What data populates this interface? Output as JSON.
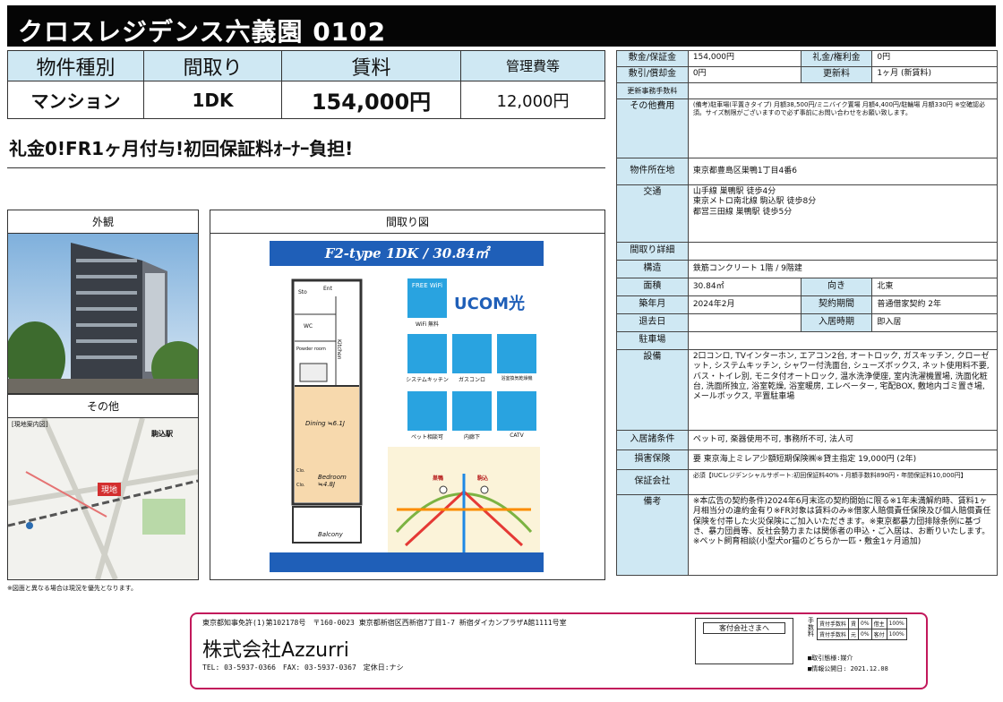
{
  "title": "クロスレジデンス六義園 0102",
  "summary": {
    "headers": [
      "物件種別",
      "間取り",
      "賃料",
      "管理費等"
    ],
    "values": [
      "マンション",
      "1DK",
      "154,000円",
      "12,000円"
    ]
  },
  "catch_copy": "礼金0!FR1ヶ月付与!初回保証料ｵｰﾅｰ負担!",
  "exterior": {
    "label": "外観"
  },
  "other": {
    "label": "その他",
    "map_title": "[現地案内図]",
    "map_marker": "現地",
    "station_label": "駒込駅"
  },
  "floorplan": {
    "label": "間取り図",
    "banner": "F2-type 1DK / 30.84㎡",
    "rooms": [
      "Ent",
      "Sto",
      "WC",
      "Powder room",
      "Kitchen",
      "Dining ≒6.1J",
      "Bedroom ≒4.8J",
      "Clo.",
      "Clo.",
      "Balcony"
    ],
    "features": [
      "FREE WiFi",
      "WiFi 無料",
      "システムキッチン",
      "ガスコンロ",
      "浴室換気乾燥機",
      "ペット相談可",
      "内廊下",
      "CATV"
    ],
    "ucom_text": "UCOM光",
    "map_stations": [
      "巣鴨",
      "駒込"
    ]
  },
  "disclaimer": "※図面と異なる場合は現況を優先となります。",
  "spec": {
    "deposit_label": "敷金/保証金",
    "deposit": "154,000円",
    "key_money_label": "礼金/権利金",
    "key_money": "0円",
    "shikibiki_label": "敷引/償却金",
    "shikibiki": "0円",
    "renewal_label": "更新料",
    "renewal": "1ヶ月 (新賃料)",
    "renewal_fee_label": "更新事務手数料",
    "renewal_fee": "",
    "other_cost_label": "その他費用",
    "other_cost": "(備考)駐車場(平置きタイプ) 月額38,500円/ミニバイク置場 月額4,400円/駐輪場 月額330円 ※空確認必須。サイズ制限がございますので必ず事前にお問い合わせをお願い致します。",
    "address_label": "物件所在地",
    "address": "東京都豊島区巣鴨1丁目4番6",
    "transport_label": "交通",
    "transport": [
      "山手線 巣鴨駅 徒歩4分",
      "東京メトロ南北線 駒込駅 徒歩8分",
      "都営三田線 巣鴨駅 徒歩5分"
    ],
    "layout_detail_label": "間取り詳細",
    "layout_detail": "",
    "structure_label": "構造",
    "structure": "鉄筋コンクリート 1階 / 9階建",
    "area_label": "面積",
    "area": "30.84㎡",
    "direction_label": "向き",
    "direction": "北東",
    "built_label": "築年月",
    "built": "2024年2月",
    "contract_label": "契約期間",
    "contract": "普通借家契約 2年",
    "vacate_label": "退去日",
    "vacate": "",
    "move_in_label": "入居時期",
    "move_in": "即入居",
    "parking_label": "駐車場",
    "parking": "",
    "equipment_label": "設備",
    "equipment": "2口コンロ, TVインターホン, エアコン2台, オートロック, ガスキッチン, クローゼット, システムキッチン, シャワー付洗面台, シューズボックス, ネット使用料不要, バス・トイレ別, モニタ付オートロック, 温水洗浄便座, 室内洗濯機置場, 洗面化粧台, 洗面所独立, 浴室乾燥, 浴室暖房, エレベーター, 宅配BOX, 敷地内ゴミ置き場, メールボックス, 平置駐車場",
    "conditions_label": "入居諸条件",
    "conditions": "ペット可, 楽器使用不可, 事務所不可, 法人可",
    "insurance_label": "損害保険",
    "insurance": "要 東京海上ミレア少額短期保険㈱※貸主指定 19,000円 (2年)",
    "guarantor_label": "保証会社",
    "guarantor": "必須【IUCレジデンシャルサポート:初回保証料40%・月額手数料890円・年間保証料10,000円】",
    "remarks_label": "備考",
    "remarks": "※本広告の契約条件)2024年6月末迄の契約開始に限る※1年未満解約時、賃料1ヶ月相当分の違約金有り※FR対象は賃料のみ※借家人賠償責任保険及び個人賠償責任保険を付帯した火災保険にご加入いただきます。※東京都暴力団排除条例に基づき、暴力団員等、反社会勢力または関係者の申込・ご入居は、お断りいたします。※ペット飼育相談(小型犬or猫のどちらか一匹・敷金1ヶ月追加)"
  },
  "footer": {
    "license": "東京都知事免許(1)第102178号　〒160-0023 東京都新宿区西新宿7丁目1-7 新宿ダイカンプラザA館1111号室",
    "company": "株式会社Azzurri",
    "contact": "TEL: 03-5937-0366　FAX: 03-5937-0367　定休日:ナシ",
    "stamp_label": "客付会社さまへ",
    "fee_side": "手数料",
    "fee_rows": [
      [
        "賃付手数料",
        "賃",
        "0%",
        "借主",
        "100%"
      ],
      [
        "賃付手数料",
        "元",
        "0%",
        "客付",
        "100%"
      ]
    ],
    "transaction": "■取引態様:媒介",
    "published": "■情報公開日: 2021.12.08"
  },
  "colors": {
    "header_blue": "#cfe8f3",
    "title_bg": "#050505",
    "footer_border": "#c2185b",
    "plan_banner": "#1f5fb8"
  }
}
